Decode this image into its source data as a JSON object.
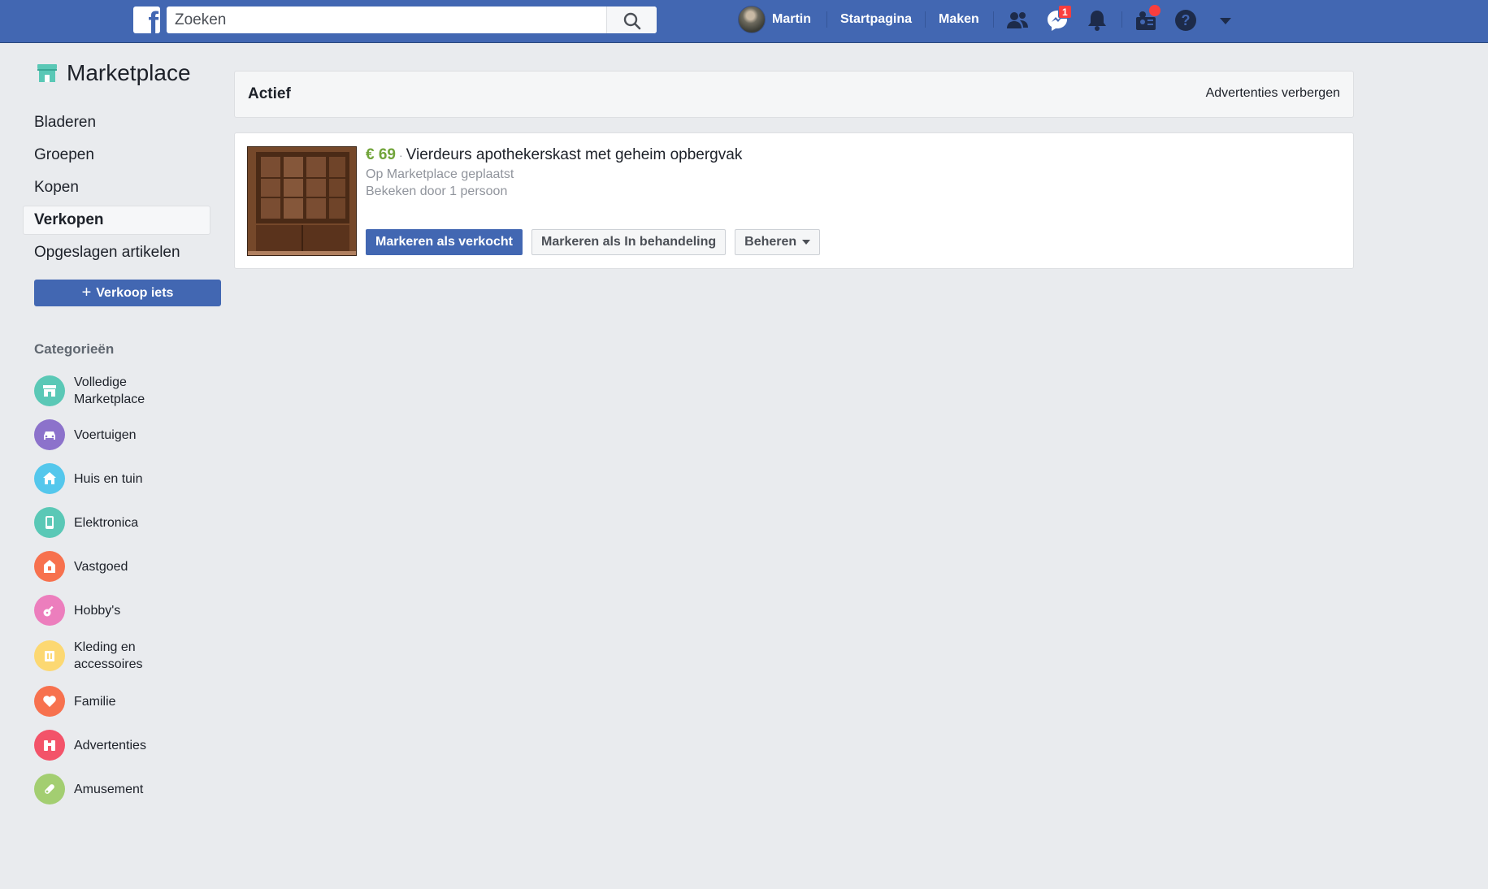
{
  "topbar": {
    "search_placeholder": "Zoeken",
    "user_name": "Martin",
    "home_link": "Startpagina",
    "create_link": "Maken",
    "messenger_badge": "1",
    "icons": [
      "facebook-logo-icon",
      "search-icon",
      "friend-requests-icon",
      "messenger-icon",
      "notifications-icon",
      "groups-icon",
      "help-icon",
      "account-menu-icon"
    ]
  },
  "sidebar": {
    "title": "Marketplace",
    "nav": [
      {
        "label": "Bladeren",
        "active": false
      },
      {
        "label": "Groepen",
        "active": false
      },
      {
        "label": "Kopen",
        "active": false
      },
      {
        "label": "Verkopen",
        "active": true
      },
      {
        "label": "Opgeslagen artikelen",
        "active": false
      }
    ],
    "sell_button": "Verkoop iets",
    "categories_heading": "Categorieën",
    "categories": [
      {
        "label": "Volledige Marketplace",
        "icon": "storefront-icon",
        "color": "#5ac8b6"
      },
      {
        "label": "Voertuigen",
        "icon": "car-icon",
        "color": "#8c72cb"
      },
      {
        "label": "Huis en tuin",
        "icon": "house-icon",
        "color": "#54c7ec"
      },
      {
        "label": "Elektronica",
        "icon": "phone-icon",
        "color": "#5ac8b6"
      },
      {
        "label": "Vastgoed",
        "icon": "real-estate-icon",
        "color": "#f7714e"
      },
      {
        "label": "Hobby's",
        "icon": "guitar-icon",
        "color": "#ec7ebd"
      },
      {
        "label": "Kleding en accessoires",
        "icon": "clothing-icon",
        "color": "#fcd872"
      },
      {
        "label": "Familie",
        "icon": "heart-icon",
        "color": "#f7714e"
      },
      {
        "label": "Advertenties",
        "icon": "binoculars-icon",
        "color": "#f35369"
      },
      {
        "label": "Amusement",
        "icon": "ticket-icon",
        "color": "#a3ce71"
      }
    ]
  },
  "main": {
    "section_title": "Actief",
    "hide_ads": "Advertenties verbergen",
    "listing": {
      "price": "€ 69",
      "separator": "·",
      "title": "Vierdeurs apothekerskast met geheim opbergvak",
      "posted": "Op Marketplace geplaatst",
      "views": "Bekeken door 1 persoon",
      "mark_sold": "Markeren als verkocht",
      "mark_pending": "Markeren als In behandeling",
      "manage": "Beheren"
    }
  },
  "colors": {
    "brand_blue": "#4267b2",
    "price_green": "#71a43a",
    "background": "#e9ebee"
  }
}
